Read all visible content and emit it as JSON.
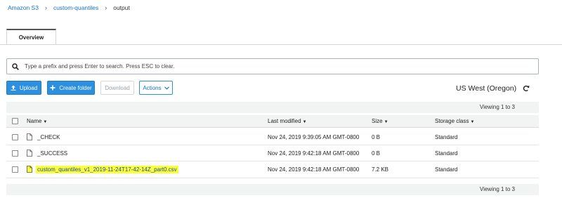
{
  "breadcrumb": {
    "items": [
      {
        "label": "Amazon S3"
      },
      {
        "label": "custom-quantiles"
      },
      {
        "label": "output"
      }
    ],
    "separator": "›"
  },
  "tabs": [
    {
      "label": "Overview",
      "active": true
    }
  ],
  "search": {
    "placeholder": "Type a prefix and press Enter to search. Press ESC to clear.",
    "value": ""
  },
  "toolbar": {
    "upload_label": "Upload",
    "create_folder_label": "Create folder",
    "download_label": "Download",
    "actions_label": "Actions"
  },
  "region": {
    "label": "US West (Oregon)"
  },
  "pagination": {
    "top": "Viewing 1 to 3",
    "bottom": "Viewing 1 to 3"
  },
  "table": {
    "columns": [
      {
        "label": "Name"
      },
      {
        "label": "Last modified"
      },
      {
        "label": "Size"
      },
      {
        "label": "Storage class"
      }
    ],
    "rows": [
      {
        "name": "_CHECK",
        "modified": "Nov 24, 2019 9:39:05 AM GMT-0800",
        "size": "0 B",
        "storage": "Standard",
        "highlighted": false
      },
      {
        "name": "_SUCCESS",
        "modified": "Nov 24, 2019 9:42:18 AM GMT-0800",
        "size": "0 B",
        "storage": "Standard",
        "highlighted": false
      },
      {
        "name": "custom_quantiles_v1_2019-11-24T17-42-14Z_part0.csv",
        "modified": "Nov 24, 2019 9:42:18 AM GMT-0800",
        "size": "7.2 KB",
        "storage": "Standard",
        "highlighted": true
      }
    ]
  },
  "colors": {
    "accent": "#2d8fe0",
    "link": "#1a73c7",
    "highlight": "#fbff3c",
    "header_bg": "#f2f3f3"
  }
}
